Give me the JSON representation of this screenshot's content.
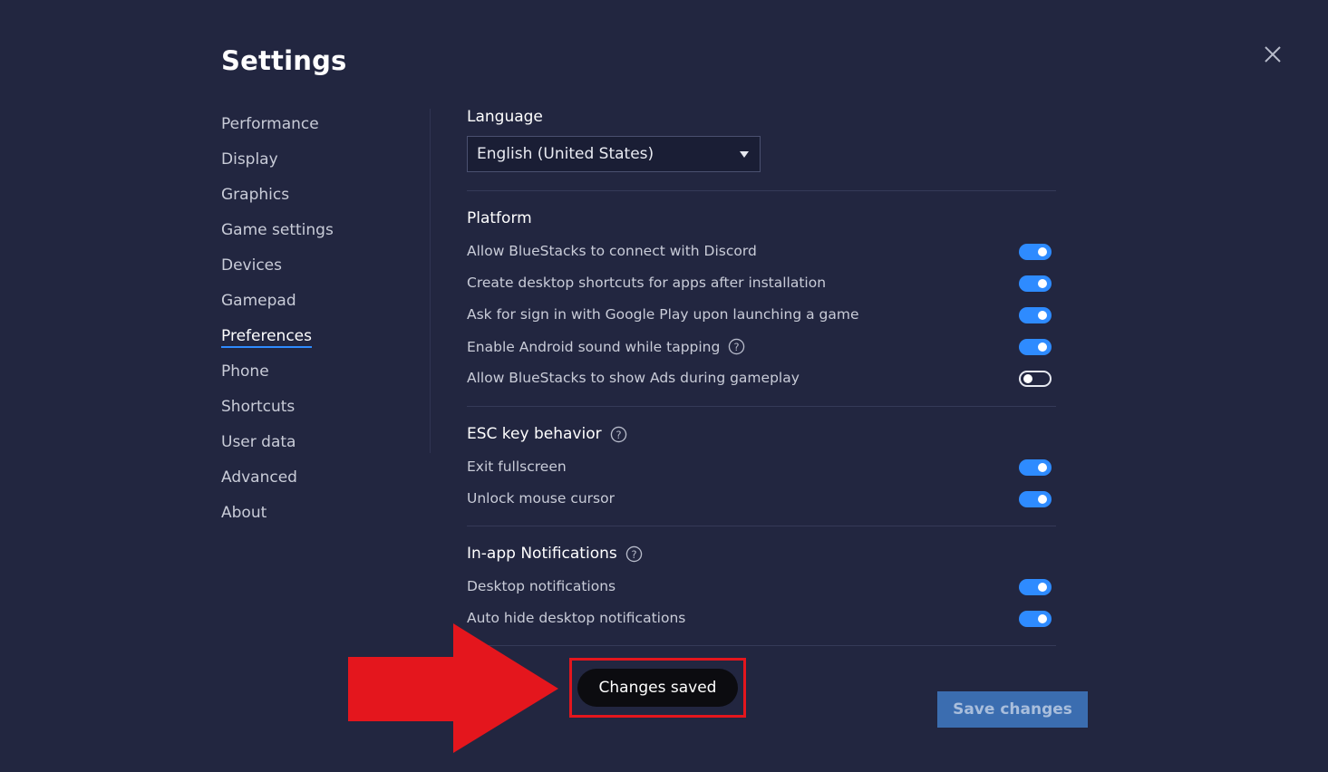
{
  "title": "Settings",
  "sidebar": {
    "items": [
      {
        "label": "Performance"
      },
      {
        "label": "Display"
      },
      {
        "label": "Graphics"
      },
      {
        "label": "Game settings"
      },
      {
        "label": "Devices"
      },
      {
        "label": "Gamepad"
      },
      {
        "label": "Preferences",
        "active": true
      },
      {
        "label": "Phone"
      },
      {
        "label": "Shortcuts"
      },
      {
        "label": "User data"
      },
      {
        "label": "Advanced"
      },
      {
        "label": "About"
      }
    ]
  },
  "language": {
    "heading": "Language",
    "selected": "English (United States)"
  },
  "platform": {
    "heading": "Platform",
    "items": [
      {
        "label": "Allow BlueStacks to connect with Discord",
        "on": true
      },
      {
        "label": "Create desktop shortcuts for apps after installation",
        "on": true
      },
      {
        "label": "Ask for sign in with Google Play upon launching a game",
        "on": true
      },
      {
        "label": "Enable Android sound while tapping",
        "on": true,
        "help": true
      },
      {
        "label": "Allow BlueStacks to show Ads during gameplay",
        "on": false
      }
    ]
  },
  "esc": {
    "heading": "ESC key behavior",
    "items": [
      {
        "label": "Exit fullscreen",
        "on": true
      },
      {
        "label": "Unlock mouse cursor",
        "on": true
      }
    ]
  },
  "notifications": {
    "heading": "In-app Notifications",
    "items": [
      {
        "label": "Desktop notifications",
        "on": true
      },
      {
        "label": "Auto hide desktop notifications",
        "on": true
      }
    ]
  },
  "toast": "Changes saved",
  "save_label": "Save changes",
  "icons": {
    "close": "close-icon",
    "help": "help-circle-icon",
    "caret": "caret-down-icon",
    "annotation": "red-arrow-right"
  },
  "colors": {
    "background": "#222640",
    "accent": "#2e8bff",
    "save_button": "#3b6db0",
    "annotation_red": "#e4161d"
  }
}
